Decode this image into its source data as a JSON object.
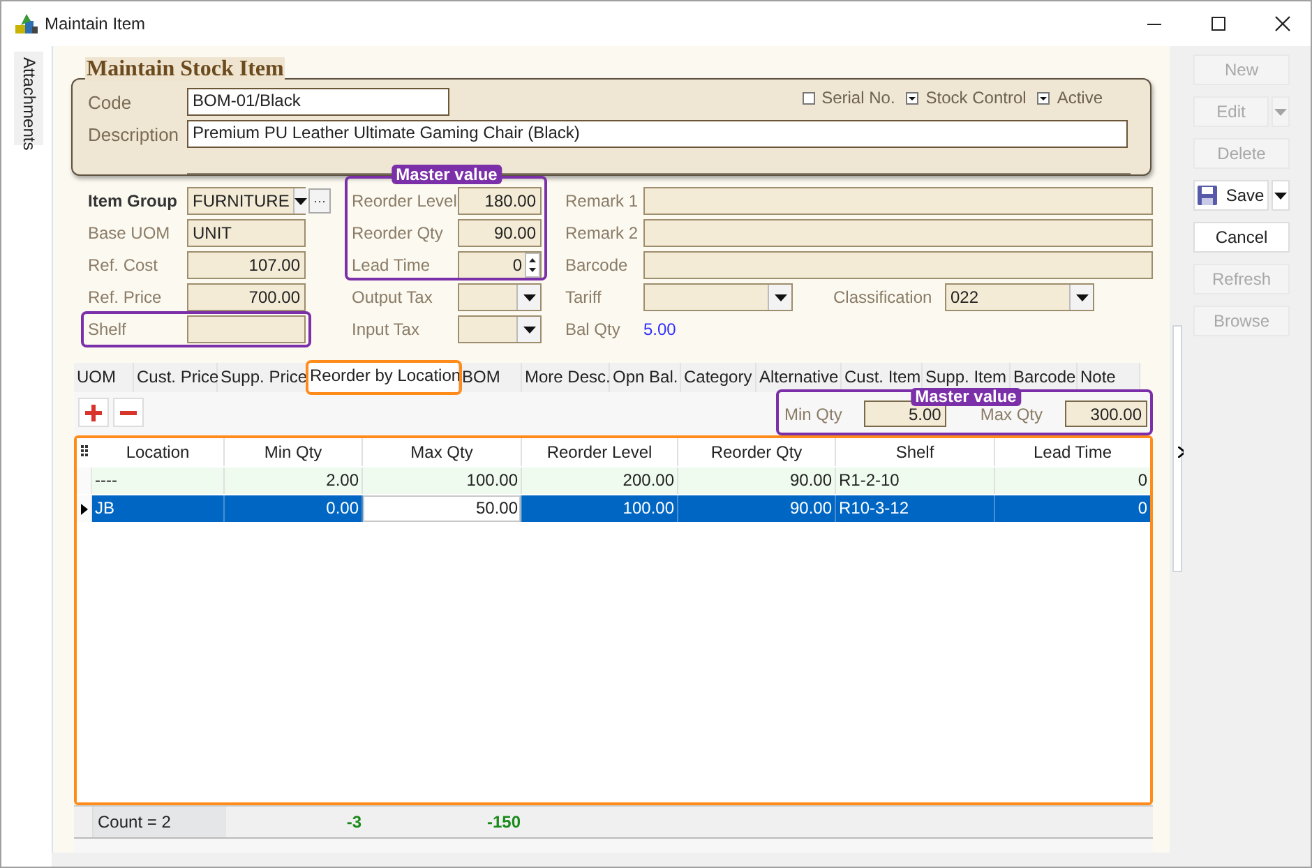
{
  "window": {
    "title": "Maintain Item"
  },
  "side_tabs": [
    {
      "label": "Attachments"
    }
  ],
  "header": {
    "title": "Maintain Stock Item"
  },
  "item": {
    "code": {
      "label": "Code",
      "value": "BOM-01/Black"
    },
    "description": {
      "label": "Description",
      "value": "Premium PU Leather Ultimate Gaming Chair (Black)"
    },
    "options": [
      {
        "label": "Serial No.",
        "checked": false
      },
      {
        "label": "Stock Control",
        "checked": true
      },
      {
        "label": "Active",
        "checked": true
      }
    ]
  },
  "form": {
    "columns": [
      {
        "groups": [
          {
            "rows": [
              [
                {
                  "label": "Item Group",
                  "bold": true,
                  "kind": "lookup",
                  "value": "FURNITURE",
                  "button": "···"
                }
              ],
              [
                {
                  "label": "Base UOM",
                  "bold": false,
                  "kind": "text",
                  "value": "UNIT"
                }
              ],
              [
                {
                  "label": "Ref. Cost",
                  "bold": false,
                  "kind": "number",
                  "value": "107.00"
                }
              ],
              [
                {
                  "label": "Ref. Price",
                  "bold": false,
                  "kind": "number",
                  "value": "700.00"
                }
              ]
            ]
          },
          {
            "highlight": {
              "color": "#7b2fa8"
            },
            "rows": [
              [
                {
                  "label": "Shelf",
                  "bold": false,
                  "kind": "text"
                }
              ]
            ]
          }
        ]
      },
      {
        "groups": [
          {
            "highlight": {
              "color": "#7b2fa8",
              "label": "Master value"
            },
            "rows": [
              [
                {
                  "label": "Reorder Level",
                  "bold": false,
                  "kind": "number",
                  "value": "180.00"
                }
              ],
              [
                {
                  "label": "Reorder Qty",
                  "bold": false,
                  "kind": "number",
                  "value": "90.00"
                }
              ],
              [
                {
                  "label": "Lead Time",
                  "bold": false,
                  "kind": "spin",
                  "value": "0"
                }
              ]
            ]
          },
          {
            "rows": [
              [
                {
                  "label": "Output Tax",
                  "bold": false,
                  "kind": "combo"
                }
              ],
              [
                {
                  "label": "Input Tax",
                  "bold": false,
                  "kind": "combo"
                }
              ]
            ]
          }
        ]
      },
      {
        "groups": [
          {
            "rows": [
              [
                {
                  "label": "Remark 1",
                  "bold": false,
                  "kind": "text"
                }
              ],
              [
                {
                  "label": "Remark 2",
                  "bold": false,
                  "kind": "text"
                }
              ],
              [
                {
                  "label": "Barcode",
                  "bold": false,
                  "kind": "text"
                }
              ],
              [
                {
                  "label": "Tariff",
                  "bold": false,
                  "kind": "combo"
                },
                {
                  "label": "Classification",
                  "bold": false,
                  "kind": "combo",
                  "value": "022"
                }
              ],
              [
                {
                  "label": "Bal Qty",
                  "bold": false,
                  "kind": "readout",
                  "value": "5.00"
                }
              ]
            ]
          }
        ]
      }
    ]
  },
  "tabs": [
    {
      "label": "UOM",
      "selected": false
    },
    {
      "label": "Cust. Price",
      "selected": false
    },
    {
      "label": "Supp. Price",
      "selected": false
    },
    {
      "label": "Reorder by Location",
      "selected": true,
      "highlight": {
        "color": "#ff8c1a"
      }
    },
    {
      "label": "BOM",
      "selected": false
    },
    {
      "label": "More Desc.",
      "selected": false
    },
    {
      "label": "Opn Bal.",
      "selected": false
    },
    {
      "label": "Category",
      "selected": false
    },
    {
      "label": "Alternative",
      "selected": false
    },
    {
      "label": "Cust. Item",
      "selected": false
    },
    {
      "label": "Supp. Item",
      "selected": false
    },
    {
      "label": "Barcode",
      "selected": false
    },
    {
      "label": "Note",
      "selected": false
    }
  ],
  "master_qty": {
    "highlight": {
      "color": "#7b2fa8",
      "label": "Master value"
    },
    "fields": [
      {
        "label": "Min Qty",
        "value": "5.00"
      },
      {
        "label": "Max Qty",
        "value": "300.00"
      }
    ]
  },
  "grid": {
    "highlight": {
      "color": "#ff8c1a"
    },
    "columns": [
      {
        "title": "Location",
        "kind": "text"
      },
      {
        "title": "Min Qty",
        "kind": "number"
      },
      {
        "title": "Max Qty",
        "kind": "number"
      },
      {
        "title": "Reorder Level",
        "kind": "number"
      },
      {
        "title": "Reorder Qty",
        "kind": "number"
      },
      {
        "title": "Shelf",
        "kind": "text"
      },
      {
        "title": "Lead Time",
        "kind": "number"
      }
    ],
    "rows": [
      {
        "selected": false,
        "current": false,
        "color": "#eefbee",
        "cells": [
          {
            "text": "----",
            "focused": false
          },
          {
            "text": "2.00",
            "focused": false
          },
          {
            "text": "100.00",
            "focused": false
          },
          {
            "text": "200.00",
            "focused": false
          },
          {
            "text": "90.00",
            "focused": false
          },
          {
            "text": "R1-2-10",
            "focused": false
          },
          {
            "text": "0",
            "focused": false
          }
        ]
      },
      {
        "selected": true,
        "current": true,
        "cells": [
          {
            "text": "JB",
            "focused": false
          },
          {
            "text": "0.00",
            "focused": false
          },
          {
            "text": "50.00",
            "focused": true
          },
          {
            "text": "100.00",
            "focused": false
          },
          {
            "text": "90.00",
            "focused": false
          },
          {
            "text": "R10-3-12",
            "focused": false
          },
          {
            "text": "0",
            "focused": false
          }
        ]
      }
    ],
    "summary": [
      {
        "text": "Count = 2",
        "kind": "count"
      },
      {
        "text": "-3",
        "kind": "total"
      },
      {
        "text": "-150",
        "kind": "total"
      }
    ]
  },
  "actions": [
    {
      "label": "New",
      "kind": "plain",
      "disabled": true,
      "menu": false
    },
    {
      "label": "Edit",
      "kind": "plain",
      "disabled": true,
      "menu": true
    },
    {
      "label": "Delete",
      "kind": "plain",
      "disabled": true,
      "menu": false
    },
    {
      "label": "Save",
      "kind": "save",
      "disabled": false,
      "menu": true
    },
    {
      "label": "Cancel",
      "kind": "plain",
      "disabled": false,
      "menu": false
    },
    {
      "label": "Refresh",
      "kind": "plain",
      "disabled": true,
      "menu": false
    },
    {
      "label": "Browse",
      "kind": "plain",
      "disabled": true,
      "menu": false
    }
  ]
}
